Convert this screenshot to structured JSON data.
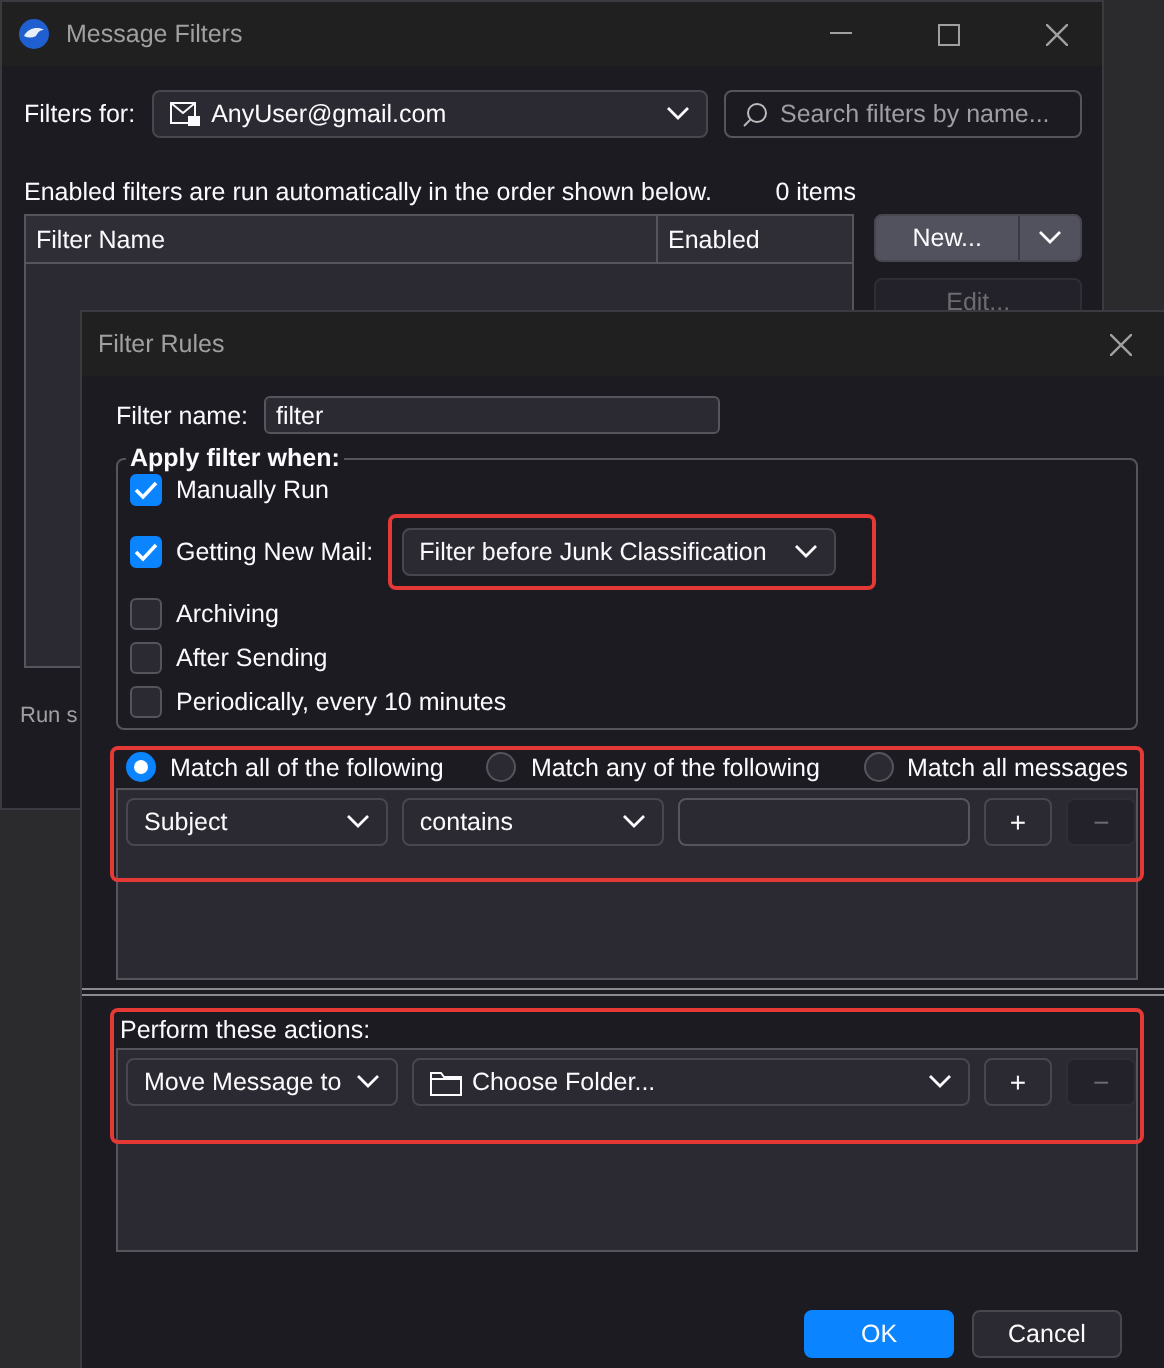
{
  "background_window": {
    "title": "Message Filters",
    "filters_for": {
      "label": "Filters for:",
      "account": "AnyUser@gmail.com"
    },
    "search": {
      "placeholder": "Search filters by name..."
    },
    "info": "Enabled filters are run automatically in the order shown below.",
    "count": "0 items",
    "columns": [
      "Filter Name",
      "Enabled"
    ],
    "buttons": [
      {
        "label": "New...",
        "kind": "split",
        "disabled": false
      },
      {
        "label": "Edit...",
        "kind": "plain",
        "disabled": true
      }
    ],
    "footer_text": "Run s"
  },
  "dialog": {
    "title": "Filter Rules",
    "filter_name": {
      "label": "Filter name:",
      "value": "filter"
    },
    "apply_when": {
      "legend": "Apply filter when:",
      "options": [
        {
          "label": "Manually Run",
          "checked": true
        },
        {
          "label": "Getting New Mail:",
          "checked": true,
          "dropdown": {
            "value": "Filter before Junk Classification",
            "highlighted": true
          }
        },
        {
          "label": "Archiving",
          "checked": false
        },
        {
          "label": "After Sending",
          "checked": false
        },
        {
          "label": "Periodically, every 10 minutes",
          "checked": false
        }
      ]
    },
    "match": {
      "highlighted": true,
      "options": [
        {
          "label": "Match all of the following",
          "selected": true
        },
        {
          "label": "Match any of the following",
          "selected": false
        },
        {
          "label": "Match all messages",
          "selected": false
        }
      ],
      "rules": [
        {
          "field": "Subject",
          "operator": "contains",
          "add": "+",
          "remove": "−",
          "remove_disabled": true
        }
      ]
    },
    "actions": {
      "highlighted": true,
      "heading": "Perform these actions:",
      "rows": [
        {
          "action": "Move Message to",
          "target": "Choose Folder...",
          "add": "+",
          "remove": "−",
          "remove_disabled": true
        }
      ]
    },
    "buttons": [
      {
        "label": "OK",
        "kind": "primary"
      },
      {
        "label": "Cancel",
        "kind": "secondary"
      }
    ]
  }
}
